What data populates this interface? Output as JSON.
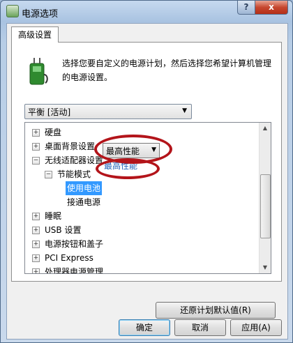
{
  "window": {
    "title": "电源选项",
    "help_label": "?",
    "close_label": "x"
  },
  "tab": {
    "label": "高级设置"
  },
  "intro_text": "选择您要自定义的电源计划，然后选择您希望计算机管理的电源设置。",
  "plan_select": {
    "value": "平衡 [活动]"
  },
  "tree": {
    "items": [
      {
        "expander": "+",
        "label": "硬盘"
      },
      {
        "expander": "+",
        "label": "桌面背景设置"
      },
      {
        "expander": "−",
        "label": "无线适配器设置"
      },
      {
        "expander": "−",
        "label": "节能模式"
      },
      {
        "expander": "",
        "label": "使用电池"
      },
      {
        "expander": "",
        "label": "接通电源"
      },
      {
        "expander": "+",
        "label": "睡眠"
      },
      {
        "expander": "+",
        "label": "USB 设置"
      },
      {
        "expander": "+",
        "label": "电源按钮和盖子"
      },
      {
        "expander": "+",
        "label": "PCI Express"
      },
      {
        "expander": "+",
        "label": "处理器电源管理"
      }
    ],
    "battery_value": "最高性能",
    "plugged_value": "最高性能"
  },
  "buttons": {
    "restore": "还原计划默认值(R)",
    "ok": "确定",
    "cancel": "取消",
    "apply": "应用(A)"
  },
  "colors": {
    "selection": "#3399ff",
    "annotation": "#b3141a",
    "link": "#1d5fb8"
  }
}
